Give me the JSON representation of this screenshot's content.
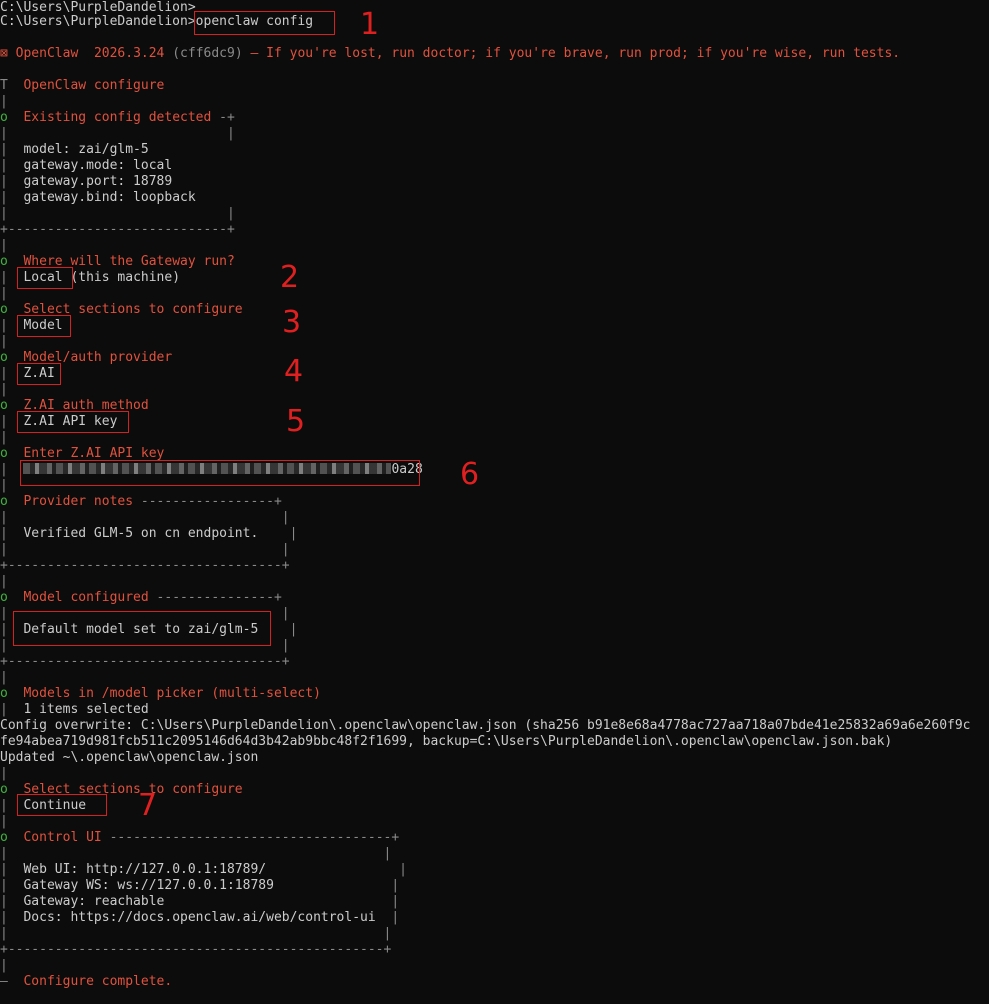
{
  "terminal": {
    "prompt_line_1": "C:\\Users\\PurpleDandelion>",
    "prompt_line_2": "C:\\Users\\PurpleDandelion>",
    "command": "openclaw config",
    "banner": {
      "icon": "lobster-icon",
      "app": "OpenClaw",
      "version": "2026.3.24",
      "build": "(cff6dc9)",
      "tagline": "— If you're lost, run doctor; if you're brave, run prod; if you're wise, run tests."
    },
    "header": "OpenClaw configure",
    "existing_config": {
      "title": "Existing config detected",
      "lines": [
        "model: zai/glm-5",
        "gateway.mode: local",
        "gateway.port: 18789",
        "gateway.bind: loopback"
      ]
    },
    "gateway_question": "Where will the Gateway run?",
    "gateway_answer": "Local",
    "gateway_answer_suffix": "(this machine)",
    "sections_question": "Select sections to configure",
    "sections_answer": "Model",
    "provider_question": "Model/auth provider",
    "provider_answer": "Z.AI",
    "auth_question": "Z.AI auth method",
    "auth_answer": "Z.AI API key",
    "key_question": "Enter Z.AI API key",
    "key_tail": "0a28",
    "provider_notes": {
      "title": "Provider notes",
      "line": "Verified GLM-5 on cn endpoint."
    },
    "model_configured": {
      "title": "Model configured",
      "line": "Default model set to zai/glm-5"
    },
    "models_picker": "Models in /model picker (multi-select)",
    "models_picker_count": "1 items selected",
    "overwrite_line_1": "Config overwrite: C:\\Users\\PurpleDandelion\\.openclaw\\openclaw.json (sha256 b91e8e68a4778ac727aa718a07bde41e25832a69a6e260f9c",
    "overwrite_line_2": "fe94abea719d981fcb511c2095146d64d3b42ab9bbc48f2f1699, backup=C:\\Users\\PurpleDandelion\\.openclaw\\openclaw.json.bak)",
    "updated_line": "Updated ~\\.openclaw\\openclaw.json",
    "sections_question_2": "Select sections to configure",
    "sections_answer_2": "Continue",
    "control_ui": {
      "title": "Control UI",
      "lines": [
        "Web UI: http://127.0.0.1:18789/",
        "Gateway WS: ws://127.0.0.1:18789",
        "Gateway: reachable",
        "Docs: https://docs.openclaw.ai/web/control-ui"
      ]
    },
    "footer": "Configure complete."
  },
  "annotations": [
    "1",
    "2",
    "3",
    "4",
    "5",
    "6",
    "7"
  ],
  "colors": {
    "background": "#0c0c0c",
    "text": "#cccccc",
    "accent": "#e0523e",
    "step": "#3fb23f",
    "annotation": "#d42020"
  }
}
